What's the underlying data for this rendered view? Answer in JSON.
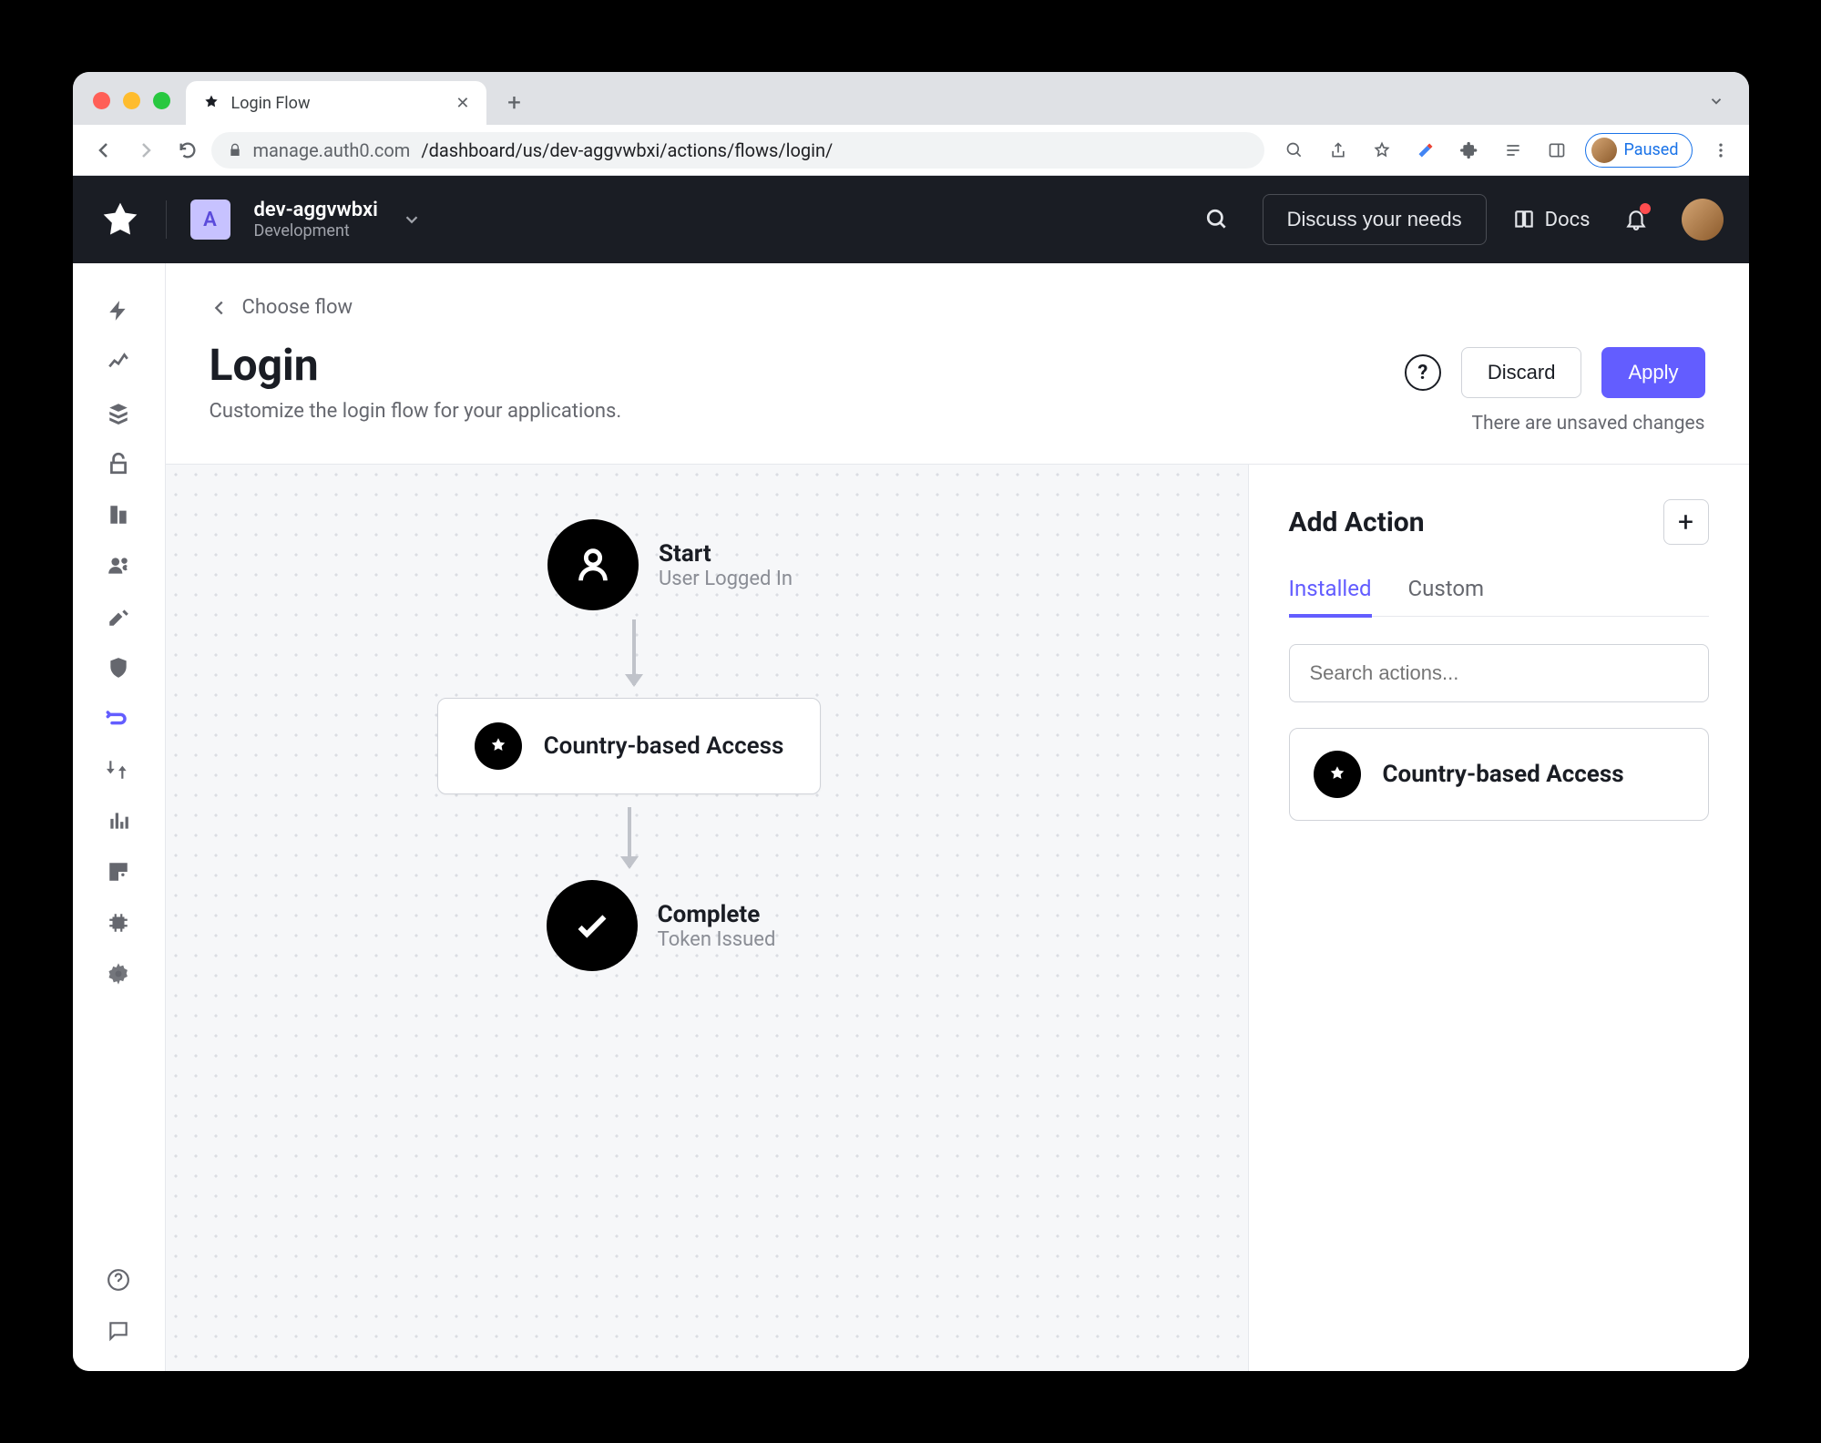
{
  "browser": {
    "tab_title": "Login Flow",
    "url_host": "manage.auth0.com",
    "url_path": "/dashboard/us/dev-aggvwbxi/actions/flows/login/",
    "profile_status": "Paused"
  },
  "header": {
    "tenant_initial": "A",
    "tenant_name": "dev-aggvwbxi",
    "tenant_env": "Development",
    "discuss_label": "Discuss your needs",
    "docs_label": "Docs"
  },
  "page": {
    "back_label": "Choose flow",
    "title": "Login",
    "subtitle": "Customize the login flow for your applications.",
    "discard_label": "Discard",
    "apply_label": "Apply",
    "unsaved_msg": "There are unsaved changes"
  },
  "flow": {
    "start_title": "Start",
    "start_sub": "User Logged In",
    "action_label": "Country-based Access",
    "complete_title": "Complete",
    "complete_sub": "Token Issued"
  },
  "panel": {
    "title": "Add Action",
    "tab_installed": "Installed",
    "tab_custom": "Custom",
    "search_placeholder": "Search actions...",
    "items": [
      {
        "label": "Country-based Access"
      }
    ]
  },
  "colors": {
    "accent": "#635dff",
    "header_bg": "#1a1d24",
    "canvas_bg": "#f6f7f9"
  }
}
